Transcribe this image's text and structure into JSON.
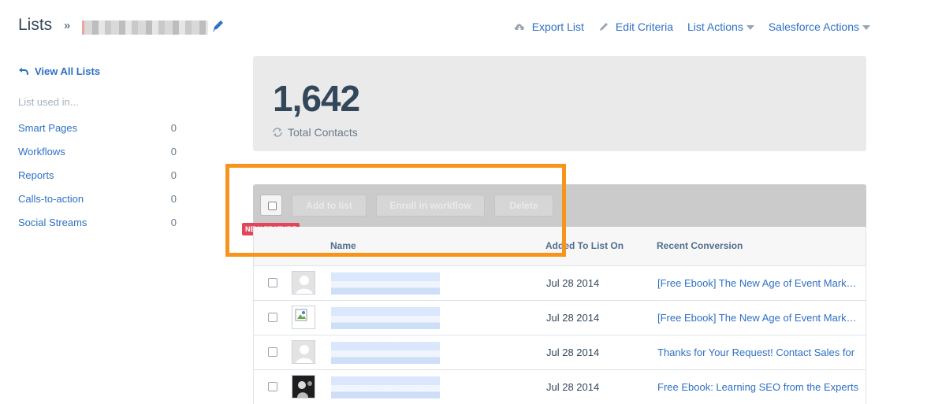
{
  "header": {
    "title": "Lists",
    "breadcrumb_separator": "»",
    "actions": [
      {
        "label": "Export List",
        "icon": "cloud-download-icon"
      },
      {
        "label": "Edit Criteria",
        "icon": "pencil-icon"
      },
      {
        "label": "List Actions",
        "icon": "caret-down-icon"
      },
      {
        "label": "Salesforce Actions",
        "icon": "caret-down-icon"
      }
    ]
  },
  "sidebar": {
    "view_all": "View All Lists",
    "used_in_label": "List used in...",
    "items": [
      {
        "label": "Smart Pages",
        "count": "0"
      },
      {
        "label": "Workflows",
        "count": "0"
      },
      {
        "label": "Reports",
        "count": "0"
      },
      {
        "label": "Calls-to-action",
        "count": "0"
      },
      {
        "label": "Social Streams",
        "count": "0"
      }
    ]
  },
  "stats": {
    "total": "1,642",
    "label": "Total Contacts"
  },
  "toolbar": {
    "add_to_list": "Add to list",
    "enroll": "Enroll in workflow",
    "delete": "Delete",
    "badge": "NEW FEATURE"
  },
  "table": {
    "columns": {
      "name": "Name",
      "added": "Added To List On",
      "conversion": "Recent Conversion"
    },
    "rows": [
      {
        "date": "Jul 28 2014",
        "conversion": "[Free Ebook] The New Age of Event Marketing"
      },
      {
        "date": "Jul 28 2014",
        "conversion": "[Free Ebook] The New Age of Event Marketing"
      },
      {
        "date": "Jul 28 2014",
        "conversion": "Thanks for Your Request! Contact Sales for"
      },
      {
        "date": "Jul 28 2014",
        "conversion": "Free Ebook: Learning SEO from the Experts"
      }
    ]
  },
  "colors": {
    "link": "#2f70c4",
    "highlight": "#f7941d",
    "badge": "#e0475b",
    "panel": "#eaeaea"
  }
}
